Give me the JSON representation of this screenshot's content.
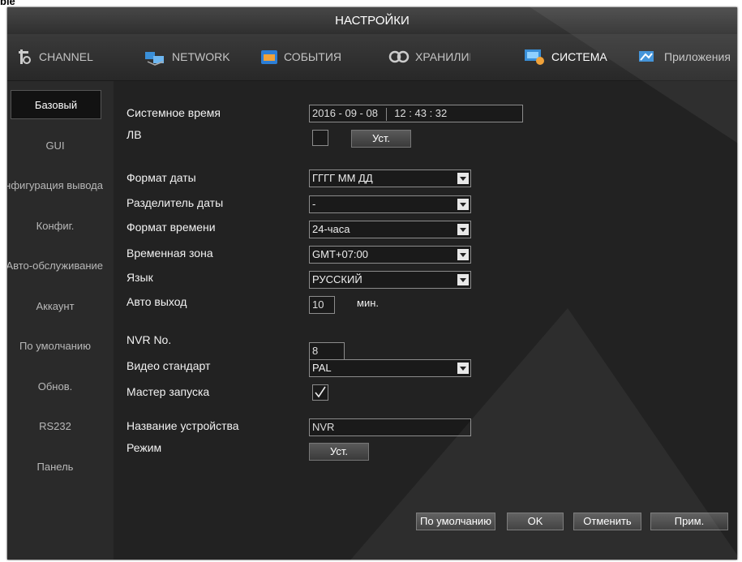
{
  "page_fragment": "ble",
  "window": {
    "title": "НАСТРОЙКИ"
  },
  "tabs": [
    {
      "label": "CHANNEL",
      "icon": "channel-icon"
    },
    {
      "label": "NETWORK",
      "icon": "network-icon"
    },
    {
      "label": "СОБЫТИЯ",
      "icon": "events-icon"
    },
    {
      "label": "ХРАНИЛИЩЕ",
      "icon": "storage-icon"
    },
    {
      "label": "СИСТЕМА",
      "icon": "system-icon",
      "active": true
    },
    {
      "label": "Приложения",
      "icon": "apps-icon"
    }
  ],
  "sidebar": {
    "items": [
      {
        "label": "Базовый",
        "active": true
      },
      {
        "label": "GUI"
      },
      {
        "label": "Конфигурация вывода"
      },
      {
        "label": "Конфиг."
      },
      {
        "label": "Авто-обслуживание"
      },
      {
        "label": "Аккаунт"
      },
      {
        "label": "По умолчанию"
      },
      {
        "label": "Обнов."
      },
      {
        "label": "RS232"
      },
      {
        "label": "Панель"
      }
    ]
  },
  "form": {
    "system_time": {
      "label": "Системное время",
      "date": "2016 - 09 - 08",
      "time": "12 : 43 : 32"
    },
    "dst": {
      "label": "ЛВ",
      "checked": false,
      "button": "Уст."
    },
    "date_format": {
      "label": "Формат даты",
      "value": "ГГГГ ММ ДД"
    },
    "date_separator": {
      "label": "Разделитель даты",
      "value": "-"
    },
    "time_format": {
      "label": "Формат времени",
      "value": "24-часа"
    },
    "timezone": {
      "label": "Временная зона",
      "value": "GMT+07:00"
    },
    "language": {
      "label": "Язык",
      "value": "РУССКИЙ"
    },
    "auto_logout": {
      "label": "Авто выход",
      "value": "10",
      "unit": "мин."
    },
    "nvr_no": {
      "label": "NVR No.",
      "value": "8"
    },
    "video_standard": {
      "label": "Видео стандарт",
      "value": "PAL"
    },
    "startup_wizard": {
      "label": "Мастер запуска",
      "checked": true
    },
    "device_name": {
      "label": "Название устройства",
      "value": "NVR"
    },
    "mode": {
      "label": "Режим",
      "button": "Уст."
    }
  },
  "footer": {
    "default_button": "По умолчанию",
    "ok_button": "OK",
    "cancel_button": "Отменить",
    "apply_button": "Прим."
  },
  "colors": {
    "background": "#222222",
    "text": "#f2f2f2",
    "active_tab": "#2f8be0"
  }
}
